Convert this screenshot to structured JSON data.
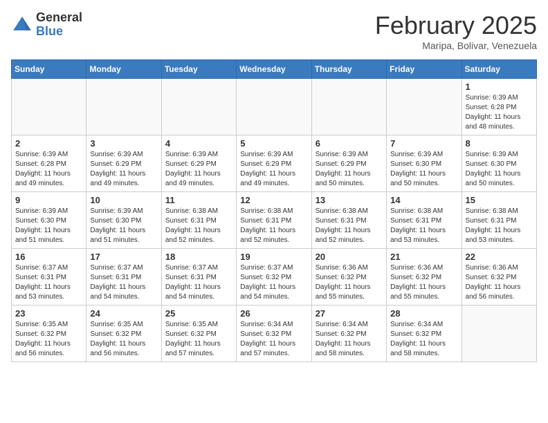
{
  "header": {
    "logo_general": "General",
    "logo_blue": "Blue",
    "month_title": "February 2025",
    "location": "Maripa, Bolivar, Venezuela"
  },
  "calendar": {
    "days_of_week": [
      "Sunday",
      "Monday",
      "Tuesday",
      "Wednesday",
      "Thursday",
      "Friday",
      "Saturday"
    ],
    "weeks": [
      [
        {
          "day": "",
          "info": ""
        },
        {
          "day": "",
          "info": ""
        },
        {
          "day": "",
          "info": ""
        },
        {
          "day": "",
          "info": ""
        },
        {
          "day": "",
          "info": ""
        },
        {
          "day": "",
          "info": ""
        },
        {
          "day": "1",
          "info": "Sunrise: 6:39 AM\nSunset: 6:28 PM\nDaylight: 11 hours and 48 minutes."
        }
      ],
      [
        {
          "day": "2",
          "info": "Sunrise: 6:39 AM\nSunset: 6:28 PM\nDaylight: 11 hours and 49 minutes."
        },
        {
          "day": "3",
          "info": "Sunrise: 6:39 AM\nSunset: 6:29 PM\nDaylight: 11 hours and 49 minutes."
        },
        {
          "day": "4",
          "info": "Sunrise: 6:39 AM\nSunset: 6:29 PM\nDaylight: 11 hours and 49 minutes."
        },
        {
          "day": "5",
          "info": "Sunrise: 6:39 AM\nSunset: 6:29 PM\nDaylight: 11 hours and 49 minutes."
        },
        {
          "day": "6",
          "info": "Sunrise: 6:39 AM\nSunset: 6:29 PM\nDaylight: 11 hours and 50 minutes."
        },
        {
          "day": "7",
          "info": "Sunrise: 6:39 AM\nSunset: 6:30 PM\nDaylight: 11 hours and 50 minutes."
        },
        {
          "day": "8",
          "info": "Sunrise: 6:39 AM\nSunset: 6:30 PM\nDaylight: 11 hours and 50 minutes."
        }
      ],
      [
        {
          "day": "9",
          "info": "Sunrise: 6:39 AM\nSunset: 6:30 PM\nDaylight: 11 hours and 51 minutes."
        },
        {
          "day": "10",
          "info": "Sunrise: 6:39 AM\nSunset: 6:30 PM\nDaylight: 11 hours and 51 minutes."
        },
        {
          "day": "11",
          "info": "Sunrise: 6:38 AM\nSunset: 6:31 PM\nDaylight: 11 hours and 52 minutes."
        },
        {
          "day": "12",
          "info": "Sunrise: 6:38 AM\nSunset: 6:31 PM\nDaylight: 11 hours and 52 minutes."
        },
        {
          "day": "13",
          "info": "Sunrise: 6:38 AM\nSunset: 6:31 PM\nDaylight: 11 hours and 52 minutes."
        },
        {
          "day": "14",
          "info": "Sunrise: 6:38 AM\nSunset: 6:31 PM\nDaylight: 11 hours and 53 minutes."
        },
        {
          "day": "15",
          "info": "Sunrise: 6:38 AM\nSunset: 6:31 PM\nDaylight: 11 hours and 53 minutes."
        }
      ],
      [
        {
          "day": "16",
          "info": "Sunrise: 6:37 AM\nSunset: 6:31 PM\nDaylight: 11 hours and 53 minutes."
        },
        {
          "day": "17",
          "info": "Sunrise: 6:37 AM\nSunset: 6:31 PM\nDaylight: 11 hours and 54 minutes."
        },
        {
          "day": "18",
          "info": "Sunrise: 6:37 AM\nSunset: 6:31 PM\nDaylight: 11 hours and 54 minutes."
        },
        {
          "day": "19",
          "info": "Sunrise: 6:37 AM\nSunset: 6:32 PM\nDaylight: 11 hours and 54 minutes."
        },
        {
          "day": "20",
          "info": "Sunrise: 6:36 AM\nSunset: 6:32 PM\nDaylight: 11 hours and 55 minutes."
        },
        {
          "day": "21",
          "info": "Sunrise: 6:36 AM\nSunset: 6:32 PM\nDaylight: 11 hours and 55 minutes."
        },
        {
          "day": "22",
          "info": "Sunrise: 6:36 AM\nSunset: 6:32 PM\nDaylight: 11 hours and 56 minutes."
        }
      ],
      [
        {
          "day": "23",
          "info": "Sunrise: 6:35 AM\nSunset: 6:32 PM\nDaylight: 11 hours and 56 minutes."
        },
        {
          "day": "24",
          "info": "Sunrise: 6:35 AM\nSunset: 6:32 PM\nDaylight: 11 hours and 56 minutes."
        },
        {
          "day": "25",
          "info": "Sunrise: 6:35 AM\nSunset: 6:32 PM\nDaylight: 11 hours and 57 minutes."
        },
        {
          "day": "26",
          "info": "Sunrise: 6:34 AM\nSunset: 6:32 PM\nDaylight: 11 hours and 57 minutes."
        },
        {
          "day": "27",
          "info": "Sunrise: 6:34 AM\nSunset: 6:32 PM\nDaylight: 11 hours and 58 minutes."
        },
        {
          "day": "28",
          "info": "Sunrise: 6:34 AM\nSunset: 6:32 PM\nDaylight: 11 hours and 58 minutes."
        },
        {
          "day": "",
          "info": ""
        }
      ]
    ]
  }
}
